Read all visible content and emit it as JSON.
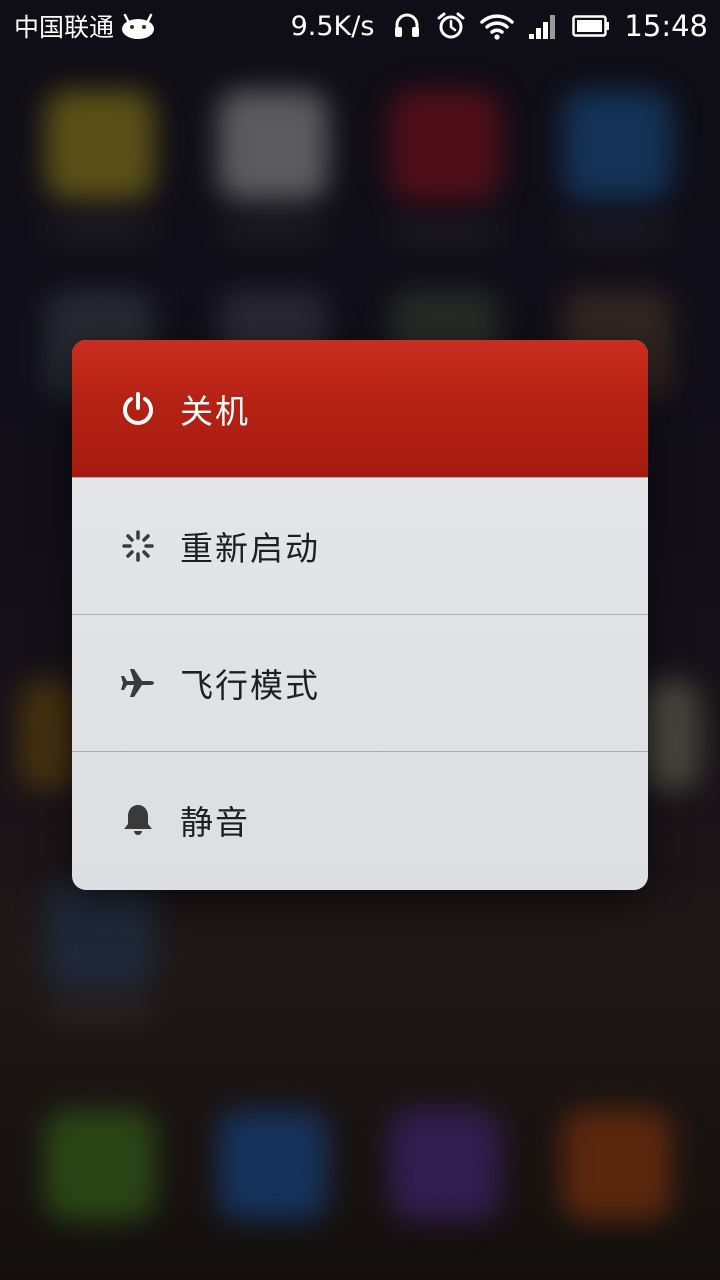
{
  "status_bar": {
    "carrier": "中国联通",
    "net_speed": "9.5K/s",
    "time": "15:48",
    "icons": [
      "android-icon",
      "headset-icon",
      "alarm-icon",
      "wifi-icon",
      "signal-icon",
      "battery-icon"
    ]
  },
  "power_menu": {
    "items": [
      {
        "label": "关机",
        "icon": "power-icon"
      },
      {
        "label": "重新启动",
        "icon": "restart-spinner-icon"
      },
      {
        "label": "飞行模式",
        "icon": "airplane-icon"
      },
      {
        "label": "静音",
        "icon": "bell-icon"
      }
    ]
  },
  "colors": {
    "power_red": "#b52214",
    "menu_bg": "#e2e4e7",
    "text_dark": "#1f1f1f"
  }
}
